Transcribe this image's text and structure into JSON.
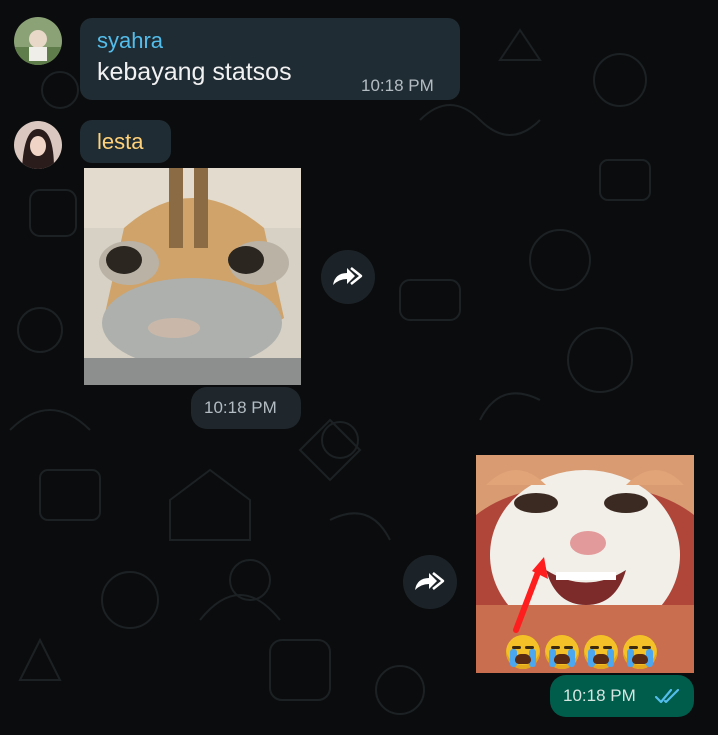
{
  "messages": [
    {
      "sender": "syahra",
      "sender_color": "#53bdeb",
      "text": "kebayang statsos",
      "time": "10:18 PM"
    },
    {
      "sender": "lesta",
      "sender_color": "#ffd279",
      "content": "cat-sticker",
      "time": "10:18 PM"
    },
    {
      "direction": "outgoing",
      "content": "crying-cat-sticker",
      "time": "10:18 PM",
      "status_icon": "double-check-icon"
    }
  ],
  "colors": {
    "background": "#0b0c0d",
    "incoming_bubble": "#202c33",
    "outgoing_bubble": "#005c4b",
    "read_receipt": "#53bdeb"
  },
  "icons": [
    "forward-icon",
    "double-check-icon",
    "crying-emoji"
  ]
}
